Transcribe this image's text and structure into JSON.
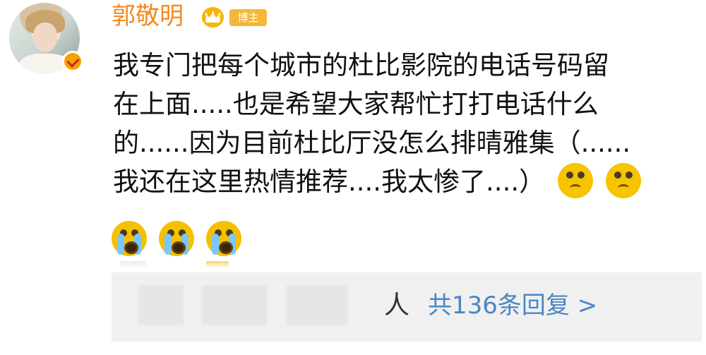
{
  "user": {
    "name": "郭敬明",
    "badge_label": "博主"
  },
  "post": {
    "lines": [
      "我专门把每个城市的杜比影院的电话号码留",
      "在上面.....也是希望大家帮忙打打电话什么",
      "的......因为目前杜比厅没怎么排晴雅集（......",
      "我还在这里热情推荐....我太惨了....）"
    ],
    "emojis_inline": [
      "sad-face",
      "sad-face"
    ],
    "emojis_row": [
      "crying-face",
      "crying-face",
      "crying-face"
    ]
  },
  "replies": {
    "people_suffix": "人",
    "summary": "共136条回复 >"
  },
  "colors": {
    "name": "#f48a1f",
    "badge": "#f4b73a",
    "link": "#4a86c5",
    "reply_bg": "#f0f0f0"
  }
}
